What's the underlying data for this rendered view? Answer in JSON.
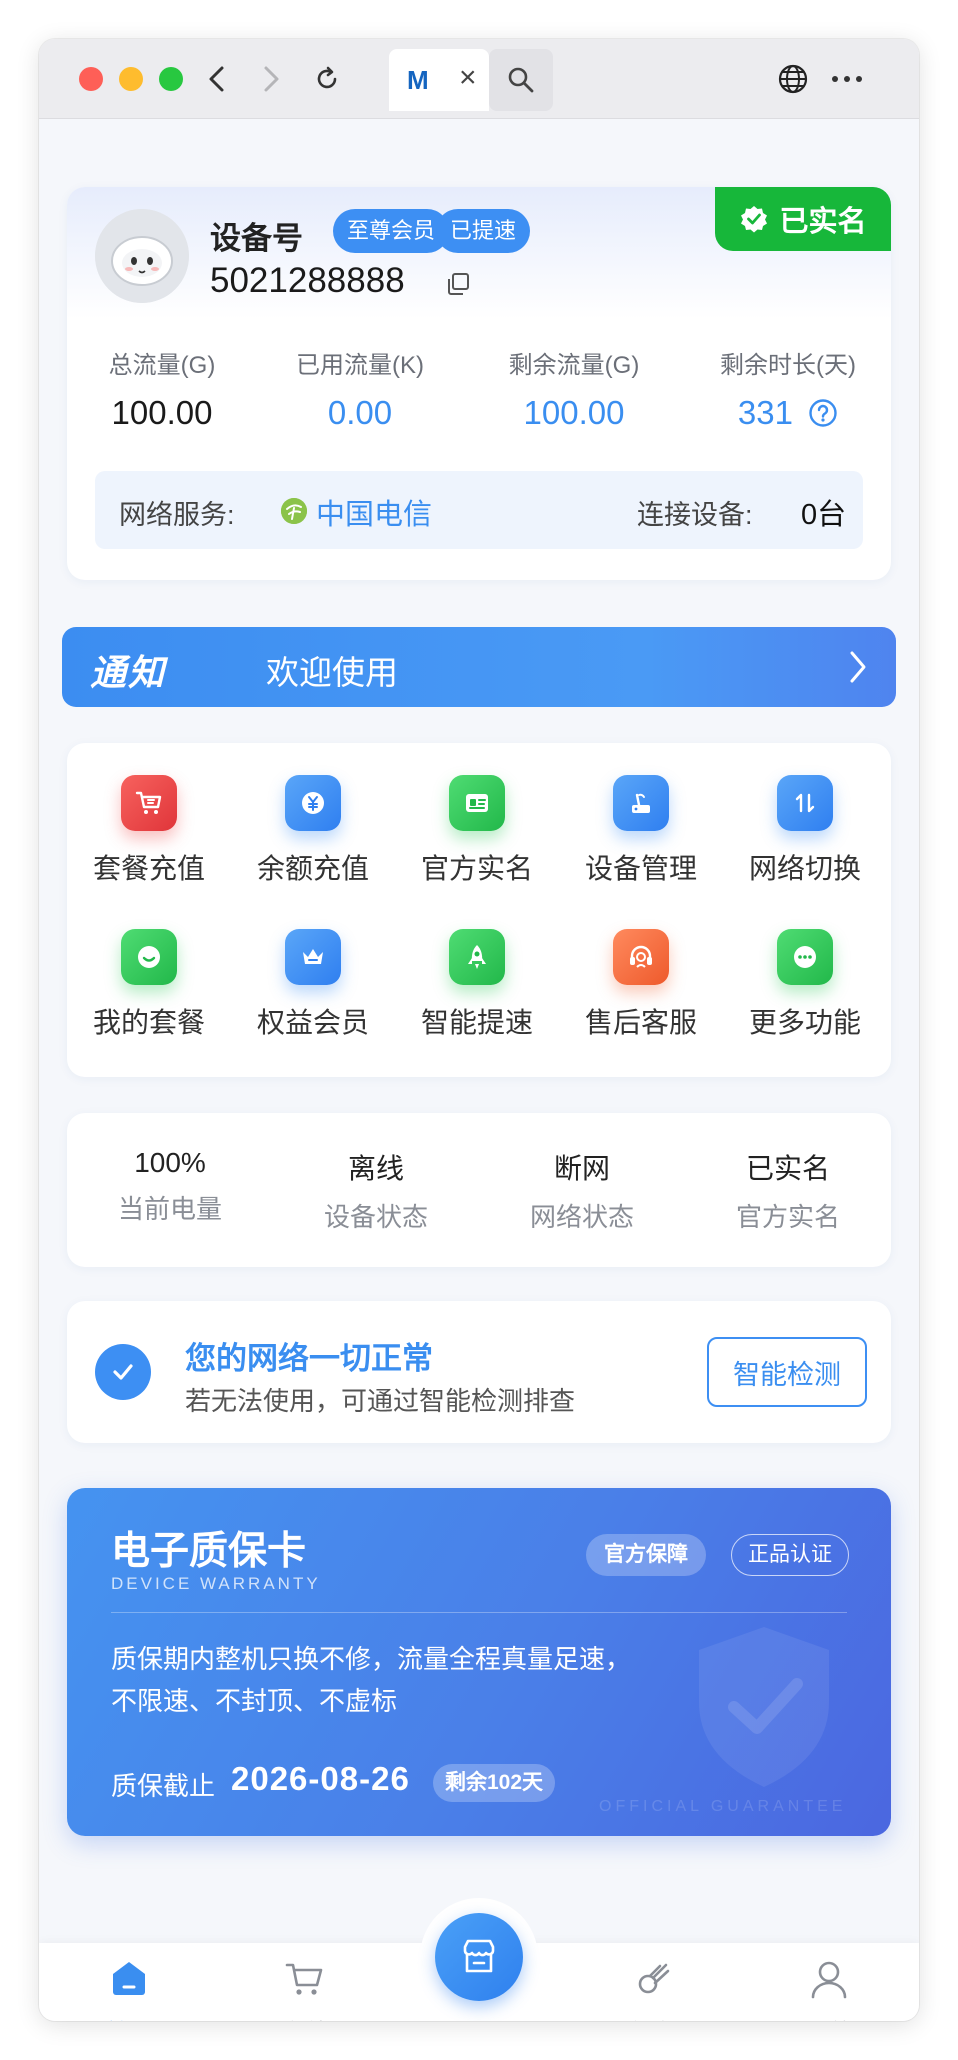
{
  "browser": {
    "tab_title": "M",
    "tab_close": "×"
  },
  "profile": {
    "device_label": "设备号",
    "badges": [
      "至尊会员",
      "已提速"
    ],
    "device_number": "5021288888",
    "verified_label": "已实名",
    "stats": [
      {
        "label": "总流量(G)",
        "value": "100.00",
        "color": "#1a1a1a"
      },
      {
        "label": "已用流量(K)",
        "value": "0.00",
        "color": "#3a8ef0"
      },
      {
        "label": "剩余流量(G)",
        "value": "100.00",
        "color": "#3a8ef0"
      },
      {
        "label": "剩余时长(天)",
        "value": "331",
        "color": "#3a8ef0"
      }
    ],
    "network_label": "网络服务:",
    "carrier": "中国电信",
    "connected_label": "连接设备:",
    "connected_value": "0台"
  },
  "notice": {
    "tag": "通知",
    "text": "欢迎使用"
  },
  "grid": {
    "items": [
      {
        "label": "套餐充值",
        "icon": "cart-icon",
        "color": "#ef4a4a"
      },
      {
        "label": "余额充值",
        "icon": "yen-coin-icon",
        "color": "#3d8ff3"
      },
      {
        "label": "官方实名",
        "icon": "id-card-icon",
        "color": "#2fc95a"
      },
      {
        "label": "设备管理",
        "icon": "router-icon",
        "color": "#3d8ff3"
      },
      {
        "label": "网络切换",
        "icon": "switch-arrows-icon",
        "color": "#3d8ff3"
      },
      {
        "label": "我的套餐",
        "icon": "smile-package-icon",
        "color": "#2fc95a"
      },
      {
        "label": "权益会员",
        "icon": "crown-icon",
        "color": "#3d8ff3"
      },
      {
        "label": "智能提速",
        "icon": "rocket-icon",
        "color": "#2fc95a"
      },
      {
        "label": "售后客服",
        "icon": "headset-icon",
        "color": "#f26a3d"
      },
      {
        "label": "更多功能",
        "icon": "more-chat-icon",
        "color": "#2fc95a"
      }
    ]
  },
  "status": {
    "items": [
      {
        "value": "100%",
        "label": "当前电量"
      },
      {
        "value": "离线",
        "label": "设备状态"
      },
      {
        "value": "断网",
        "label": "网络状态"
      },
      {
        "value": "已实名",
        "label": "官方实名"
      }
    ]
  },
  "network_ok": {
    "title": "您的网络一切正常",
    "subtitle": "若无法使用，可通过智能检测排查",
    "button": "智能检测"
  },
  "warranty": {
    "title": "电子质保卡",
    "subtitle": "DEVICE WARRANTY",
    "badge_official": "官方保障",
    "badge_genuine": "正品认证",
    "description": "质保期内整机只换不修，流量全程真量足速，不限速、不封顶、不虚标",
    "deadline_label": "质保截止",
    "deadline_date": "2026-08-26",
    "remaining": "剩余102天",
    "watermark": "OFFICIAL GUARANTEE"
  },
  "bottom_nav": {
    "items": [
      {
        "label": "首页",
        "active": true
      },
      {
        "label": "充值",
        "active": false
      },
      {
        "label": "商城",
        "active": false
      },
      {
        "label": "任务",
        "active": false
      },
      {
        "label": "我的",
        "active": false
      }
    ]
  }
}
